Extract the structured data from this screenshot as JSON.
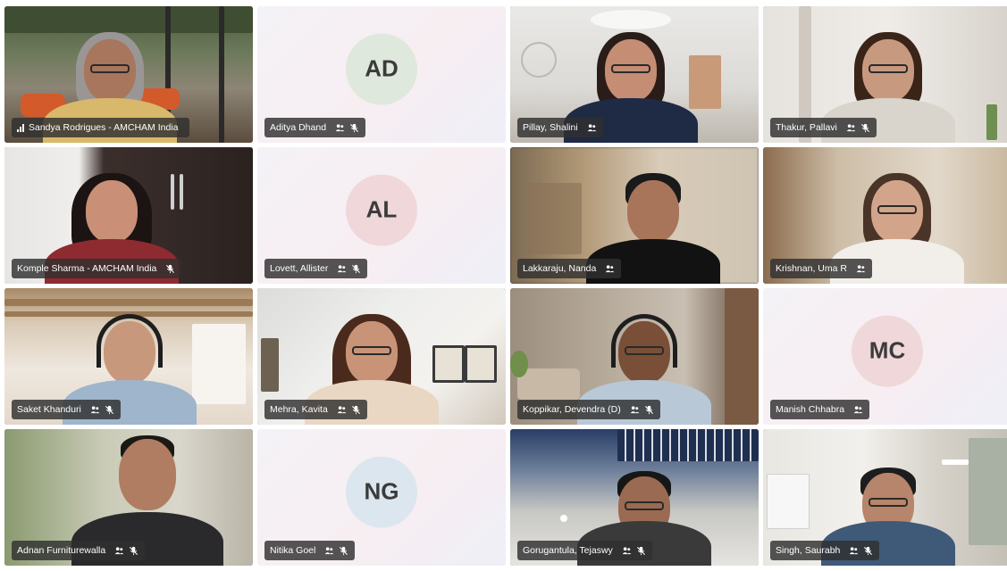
{
  "participants": [
    {
      "name": "Sandya Rodrigues - AMCHAM India",
      "video": true,
      "signal": true,
      "people_icon": false,
      "mic_muted": false,
      "scene": "glass-room"
    },
    {
      "name": "Aditya Dhand",
      "video": false,
      "initials": "AD",
      "avatar_color": "#dfe8dc",
      "people_icon": true,
      "mic_muted": true
    },
    {
      "name": "Pillay, Shalini",
      "video": true,
      "speaking": true,
      "people_icon": true,
      "mic_muted": false,
      "scene": "white-office"
    },
    {
      "name": "Thakur, Pallavi",
      "video": true,
      "people_icon": true,
      "mic_muted": true,
      "scene": "light-room"
    },
    {
      "name": "Komple Sharma - AMCHAM India",
      "video": true,
      "people_icon": false,
      "mic_muted": true,
      "scene": "dark-office"
    },
    {
      "name": "Lovett, Allister",
      "video": false,
      "initials": "AL",
      "avatar_color": "#f0d7da",
      "people_icon": true,
      "mic_muted": true
    },
    {
      "name": "Lakkaraju, Nanda",
      "video": true,
      "people_icon": true,
      "mic_muted": false,
      "scene": "blur-warm"
    },
    {
      "name": "Krishnan, Uma R",
      "video": true,
      "people_icon": true,
      "mic_muted": false,
      "scene": "blur-beige"
    },
    {
      "name": "Saket Khanduri",
      "video": true,
      "people_icon": true,
      "mic_muted": true,
      "scene": "loft"
    },
    {
      "name": "Mehra, Kavita",
      "video": true,
      "people_icon": true,
      "mic_muted": true,
      "scene": "bright-office"
    },
    {
      "name": "Koppikar, Devendra (D)",
      "video": true,
      "people_icon": true,
      "mic_muted": true,
      "scene": "living-room"
    },
    {
      "name": "Manish Chhabra",
      "video": false,
      "initials": "MC",
      "avatar_color": "#f0d7da",
      "people_icon": true,
      "mic_muted": false
    },
    {
      "name": "Adnan Furniturewalla",
      "video": true,
      "people_icon": true,
      "mic_muted": true,
      "scene": "blur-green"
    },
    {
      "name": "Nitika Goel",
      "video": false,
      "initials": "NG",
      "avatar_color": "#dce6ee",
      "people_icon": true,
      "mic_muted": true
    },
    {
      "name": "Gorugantula, Tejaswy",
      "video": true,
      "people_icon": true,
      "mic_muted": true,
      "scene": "ceiling-office"
    },
    {
      "name": "Singh, Saurabh",
      "video": true,
      "people_icon": true,
      "mic_muted": true,
      "scene": "meeting-room"
    }
  ],
  "colors": {
    "speaking_border": "#6b73d6",
    "label_background": "#303030",
    "avatar_text": "#3b3b3b"
  },
  "icons": {
    "people": "people-icon",
    "mic_off": "mic-off-icon",
    "signal": "signal-icon"
  }
}
